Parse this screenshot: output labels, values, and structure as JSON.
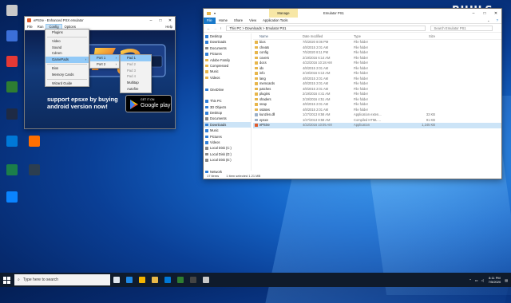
{
  "watermark": {
    "text": "RIHILS"
  },
  "desktop_icons": [
    {
      "label": "",
      "color": "#c9c9c9"
    },
    {
      "label": "",
      "color": "#3b6fd8"
    },
    {
      "label": "",
      "color": "#e53935"
    },
    {
      "label": "",
      "color": "#2e7d32"
    },
    {
      "label": "",
      "color": "#1e2a44"
    },
    {
      "label": "",
      "color": "#0078d7"
    },
    {
      "label": "",
      "color": "#ff6f00"
    },
    {
      "label": "",
      "color": "#1b7f4a"
    },
    {
      "label": "",
      "color": "#2c3e50"
    },
    {
      "label": "",
      "color": "#0a84ff"
    }
  ],
  "emulator": {
    "title": "ePSXe - Enhanced PSX emulator",
    "menu": [
      "File",
      "Run",
      "Config",
      "Options"
    ],
    "help": "Help",
    "promo_line1": "support epsxe by buying",
    "promo_line2": "android version now!",
    "gplay_small": "GET IT ON",
    "gplay_big": "Google play",
    "config_menu": [
      "Plugins",
      "Video",
      "Sound",
      "Cdrom",
      "GamePads",
      "Bios",
      "Memory Cards",
      "Wizard Guide"
    ],
    "gamepads_sub": [
      "Port 1",
      "Port 2"
    ],
    "port_sub": [
      "Pad 1",
      "Pad 2",
      "Pad 3",
      "Pad 4",
      "Multitap",
      "Autofire"
    ]
  },
  "explorer": {
    "title": "Emulator PS1",
    "manage": "Manage",
    "ribbon": [
      "File",
      "Home",
      "Share",
      "View",
      "Application Tools"
    ],
    "path": "This PC  >  Downloads  >  Emulator PS1",
    "search_placeholder": "Search Emulator PS1",
    "headers": [
      "Name",
      "Date modified",
      "Type",
      "Size"
    ],
    "nav": [
      {
        "label": "Desktop",
        "color": "#2f7fd8"
      },
      {
        "label": "Downloads",
        "color": "#2f7fd8"
      },
      {
        "label": "Documents",
        "color": "#8a8a8a"
      },
      {
        "label": "Pictures",
        "color": "#2f7fd8"
      },
      {
        "label": "Adobe Family",
        "color": "#e7b54a"
      },
      {
        "label": "Compressed",
        "color": "#e7b54a"
      },
      {
        "label": "Music",
        "color": "#e7b54a"
      },
      {
        "label": "Videos",
        "color": "#e7b54a"
      },
      {
        "label": "",
        "color": "#fff"
      },
      {
        "label": "OneDrive",
        "color": "#2f7fd8"
      },
      {
        "label": "",
        "color": "#fff"
      },
      {
        "label": "This PC",
        "color": "#2f7fd8"
      },
      {
        "label": "3D Objects",
        "color": "#2f7fd8"
      },
      {
        "label": "Desktop",
        "color": "#2f7fd8"
      },
      {
        "label": "Documents",
        "color": "#8a8a8a"
      },
      {
        "label": "Downloads",
        "color": "#2f7fd8"
      },
      {
        "label": "Music",
        "color": "#2f7fd8"
      },
      {
        "label": "Pictures",
        "color": "#2f7fd8"
      },
      {
        "label": "Videos",
        "color": "#2f7fd8"
      },
      {
        "label": "Local Disk (C:)",
        "color": "#8a8a8a"
      },
      {
        "label": "Local Disk (D:)",
        "color": "#8a8a8a"
      },
      {
        "label": "Local Disk (E:)",
        "color": "#8a8a8a"
      },
      {
        "label": "",
        "color": "#fff"
      },
      {
        "label": "Network",
        "color": "#2f7fd8"
      }
    ],
    "files": [
      {
        "name": "bios",
        "date": "7/5/2020 8:06 PM",
        "type": "File folder",
        "size": ""
      },
      {
        "name": "cheats",
        "date": "4/8/2015 2:01 AM",
        "type": "File folder",
        "size": ""
      },
      {
        "name": "config",
        "date": "7/5/2020 8:11 PM",
        "type": "File folder",
        "size": ""
      },
      {
        "name": "covers",
        "date": "2/19/2016 6:14 AM",
        "type": "File folder",
        "size": ""
      },
      {
        "name": "docs",
        "date": "4/22/2016 10:18 AM",
        "type": "File folder",
        "size": ""
      },
      {
        "name": "idx",
        "date": "4/8/2015 2:01 AM",
        "type": "File folder",
        "size": ""
      },
      {
        "name": "info",
        "date": "2/19/2016 6:13 AM",
        "type": "File folder",
        "size": ""
      },
      {
        "name": "lang",
        "date": "4/8/2015 2:01 AM",
        "type": "File folder",
        "size": ""
      },
      {
        "name": "memcards",
        "date": "4/8/2015 2:01 AM",
        "type": "File folder",
        "size": ""
      },
      {
        "name": "patches",
        "date": "4/8/2015 2:01 AM",
        "type": "File folder",
        "size": ""
      },
      {
        "name": "plugins",
        "date": "2/19/2016 4:41 AM",
        "type": "File folder",
        "size": ""
      },
      {
        "name": "shaders",
        "date": "2/19/2016 4:51 AM",
        "type": "File folder",
        "size": ""
      },
      {
        "name": "snap",
        "date": "4/8/2015 2:01 AM",
        "type": "File folder",
        "size": ""
      },
      {
        "name": "sstates",
        "date": "4/8/2015 2:01 AM",
        "type": "File folder",
        "size": ""
      },
      {
        "name": "kunzlen.dll",
        "date": "1/27/2013 8:58 AM",
        "type": "Application exten...",
        "size": "33 KB"
      },
      {
        "name": "epsxe",
        "date": "1/27/2013 8:58 AM",
        "type": "Compiled HTML ...",
        "size": "91 KB"
      },
      {
        "name": "ePSXe",
        "date": "4/22/2016 10:05 AM",
        "type": "Application",
        "size": "1,245 KB"
      }
    ],
    "status_items": "17 items",
    "status_selected": "1 item selected  1.21 MB"
  },
  "taskbar": {
    "search_placeholder": "Type here to search",
    "apps": [
      {
        "color": "#dfe6ee"
      },
      {
        "color": "#1e88e5"
      },
      {
        "color": "#f4b400"
      },
      {
        "color": "#e9b949"
      },
      {
        "color": "#0078d7"
      },
      {
        "color": "#2e7d32"
      },
      {
        "color": "#444444"
      },
      {
        "color": "#c9c9c9"
      }
    ],
    "time": "8:11 PM",
    "date": "7/5/2020"
  }
}
